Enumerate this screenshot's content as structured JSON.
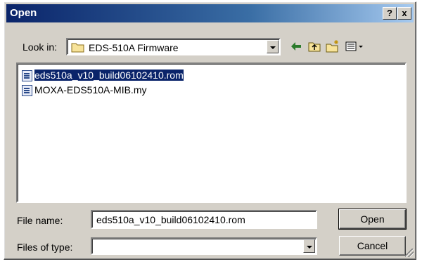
{
  "dialog": {
    "title": "Open",
    "help_button": "?",
    "close_button": "x"
  },
  "look_in": {
    "label": "Look in:",
    "value": "EDS-510A Firmware"
  },
  "files": [
    {
      "name": "eds510a_v10_build06102410.rom",
      "selected": true
    },
    {
      "name": "MOXA-EDS510A-MIB.my",
      "selected": false
    }
  ],
  "file_name": {
    "label": "File name:",
    "value": "eds510a_v10_build06102410.rom"
  },
  "file_type": {
    "label": "Files of type:",
    "value": ""
  },
  "buttons": {
    "open": "Open",
    "cancel": "Cancel"
  },
  "colors": {
    "titlebar": "#0a246a",
    "selection": "#0a246a",
    "face": "#d4d0c8"
  }
}
